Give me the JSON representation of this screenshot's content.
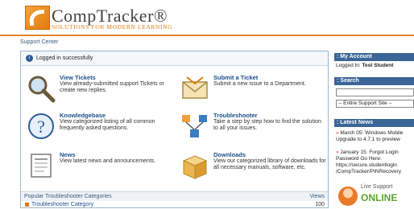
{
  "header": {
    "logo_title": "CompTracker®",
    "logo_tagline": "SOLUTIONS FOR MODERN LEARNING"
  },
  "section_title": "Support Center",
  "login_message": "Logged in successfully",
  "tiles": [
    {
      "title": "View Tickets",
      "desc": "View already-submitted support Tickets or create new replies.",
      "icon": "magnifier-icon"
    },
    {
      "title": "Submit a Ticket",
      "desc": "Submit a new issue to a Department.",
      "icon": "envelope-icon"
    },
    {
      "title": "Knowledgebase",
      "desc": "View categorized listing of all common frequently asked questions.",
      "icon": "question-icon"
    },
    {
      "title": "Troubleshooter",
      "desc": "Take a step by step how to find the solution to all your issues.",
      "icon": "network-icon"
    },
    {
      "title": "News",
      "desc": "View latest news and announcements.",
      "icon": "newspaper-icon"
    },
    {
      "title": "Downloads",
      "desc": "View our categorized library of downloads for all necessary manuals, software, etc.",
      "icon": "box-icon"
    }
  ],
  "categories": {
    "title": "Popular Troubleshooter Categories",
    "views_label": "Views",
    "rows": [
      {
        "name": "Troubleshooter Category",
        "views": "100"
      }
    ]
  },
  "sidebar": {
    "account_title": ": My Account",
    "logged_in_label": "Logged In:",
    "logged_in_user": "Test Student",
    "search_title": ": Search",
    "search_scope": "-- Entire Support Site --",
    "news_title": ": Latest News",
    "news": [
      {
        "text": "March 05: Windows Mobile Upgrade to 4.7.1 to preview"
      },
      {
        "text": "January 15: Forgot Login Password Go Here: https://secure.studentlogin /CompTracker/PINRecovery"
      }
    ],
    "support_line1": "Live Support",
    "support_line2": "ONLINE"
  },
  "colors": {
    "accent": "#e07a10",
    "sidebar_head": "#3b6597",
    "link": "#1a4f8a"
  }
}
